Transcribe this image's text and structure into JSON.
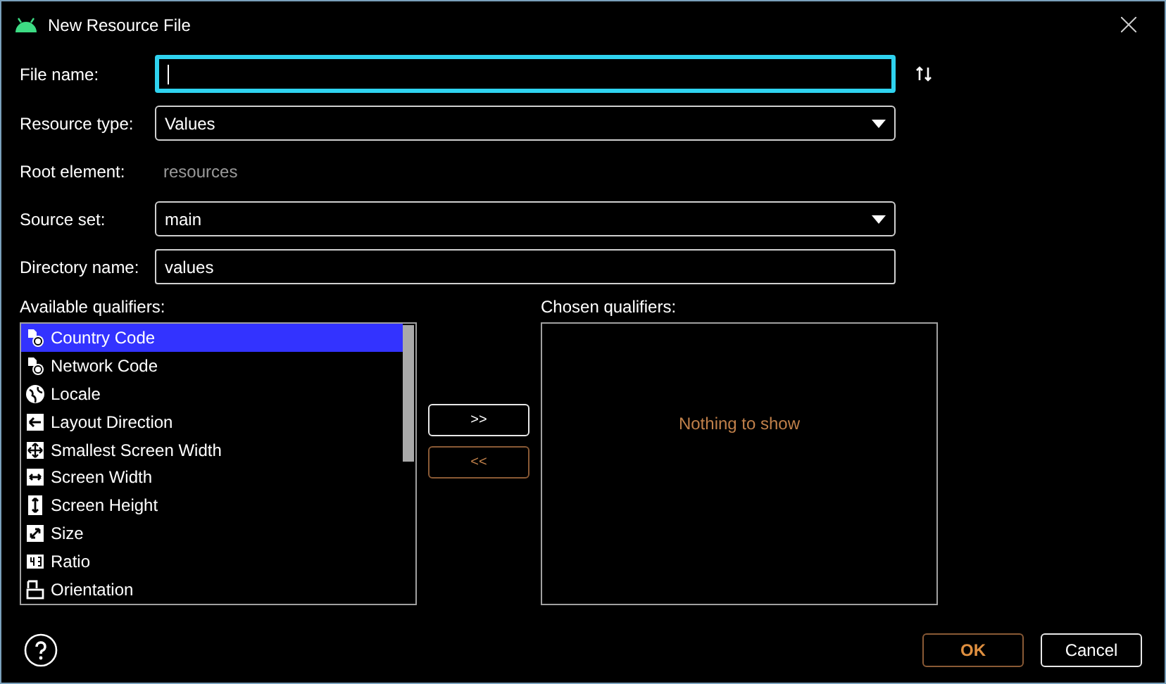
{
  "window": {
    "title": "New Resource File"
  },
  "fields": [
    {
      "label": "File name:",
      "kind": "text",
      "focused": true
    },
    {
      "label": "Resource type:",
      "kind": "dropdown",
      "value": "Values"
    },
    {
      "label": "Root element:",
      "kind": "static",
      "value": "resources"
    },
    {
      "label": "Source set:",
      "kind": "dropdown",
      "value": "main"
    },
    {
      "label": "Directory name:",
      "kind": "text",
      "value": "values"
    }
  ],
  "available_qualifiers": {
    "label": "Available qualifiers:",
    "items": [
      {
        "label": "Country Code",
        "selected": true
      },
      {
        "label": "Network Code",
        "selected": false
      },
      {
        "label": "Locale",
        "selected": false
      },
      {
        "label": "Layout Direction",
        "selected": false
      },
      {
        "label": "Smallest Screen Width",
        "selected": false
      },
      {
        "label": "Screen Width",
        "selected": false
      },
      {
        "label": "Screen Height",
        "selected": false
      },
      {
        "label": "Size",
        "selected": false
      },
      {
        "label": "Ratio",
        "selected": false
      },
      {
        "label": "Orientation",
        "selected": false
      }
    ]
  },
  "move_buttons": [
    {
      "label": ">>",
      "disabled": false
    },
    {
      "label": "<<",
      "disabled": true
    }
  ],
  "chosen_qualifiers": {
    "label": "Chosen qualifiers:",
    "empty_text": "Nothing to show"
  },
  "buttons": [
    {
      "label": "OK",
      "disabled": true
    },
    {
      "label": "Cancel",
      "disabled": false
    }
  ]
}
